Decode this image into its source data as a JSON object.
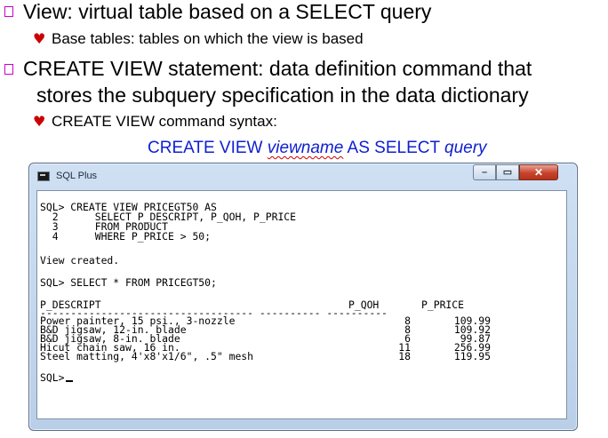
{
  "slide": {
    "bullets": [
      {
        "text": "View: virtual table based on a SELECT query"
      },
      {
        "sub": "Base tables: tables on which the view is based"
      },
      {
        "text_line1": "CREATE VIEW statement: data definition command that",
        "text_line2": "stores the subquery specification in the data dictionary"
      },
      {
        "sub": "CREATE VIEW command syntax:"
      }
    ],
    "syntax": {
      "part1": "CREATE VIEW ",
      "viewname": "viewname",
      "part2": " AS SELECT ",
      "query": "query"
    },
    "colors": {
      "bullet_square": "#cc00cc",
      "heart": "#cc0000",
      "syntax": "#1020d0"
    }
  },
  "window": {
    "title": "SQL Plus",
    "icon": "console-app-icon",
    "controls": {
      "minimize": "minimize-icon",
      "maximize": "maximize-icon",
      "close": "close-icon"
    },
    "console": {
      "lines": [
        "SQL> CREATE VIEW PRICEGT50 AS",
        "  2      SELECT P_DESCRIPT, P_QOH, P_PRICE",
        "  3      FROM PRODUCT",
        "  4      WHERE P_PRICE > 50;",
        "View created.",
        "SQL> SELECT * FROM PRICEGT50;",
        "P_DESCRIPT"
      ],
      "headers": {
        "descript": "P_DESCRIPT",
        "qoh": "P_QOH",
        "price": "P_PRICE"
      },
      "rows": [
        {
          "descript": "Power painter, 15 psi., 3-nozzle",
          "qoh": "8",
          "price": "109.99"
        },
        {
          "descript": "B&D jigsaw, 12-in. blade",
          "qoh": "8",
          "price": "109.92"
        },
        {
          "descript": "B&D jigsaw, 8-in. blade",
          "qoh": "6",
          "price": "99.87"
        },
        {
          "descript": "Hicut chain saw, 16 in.",
          "qoh": "11",
          "price": "256.99"
        },
        {
          "descript": "Steel matting, 4'x8'x1/6\", .5\" mesh",
          "qoh": "18",
          "price": "119.95"
        }
      ],
      "prompt": "SQL>"
    }
  }
}
